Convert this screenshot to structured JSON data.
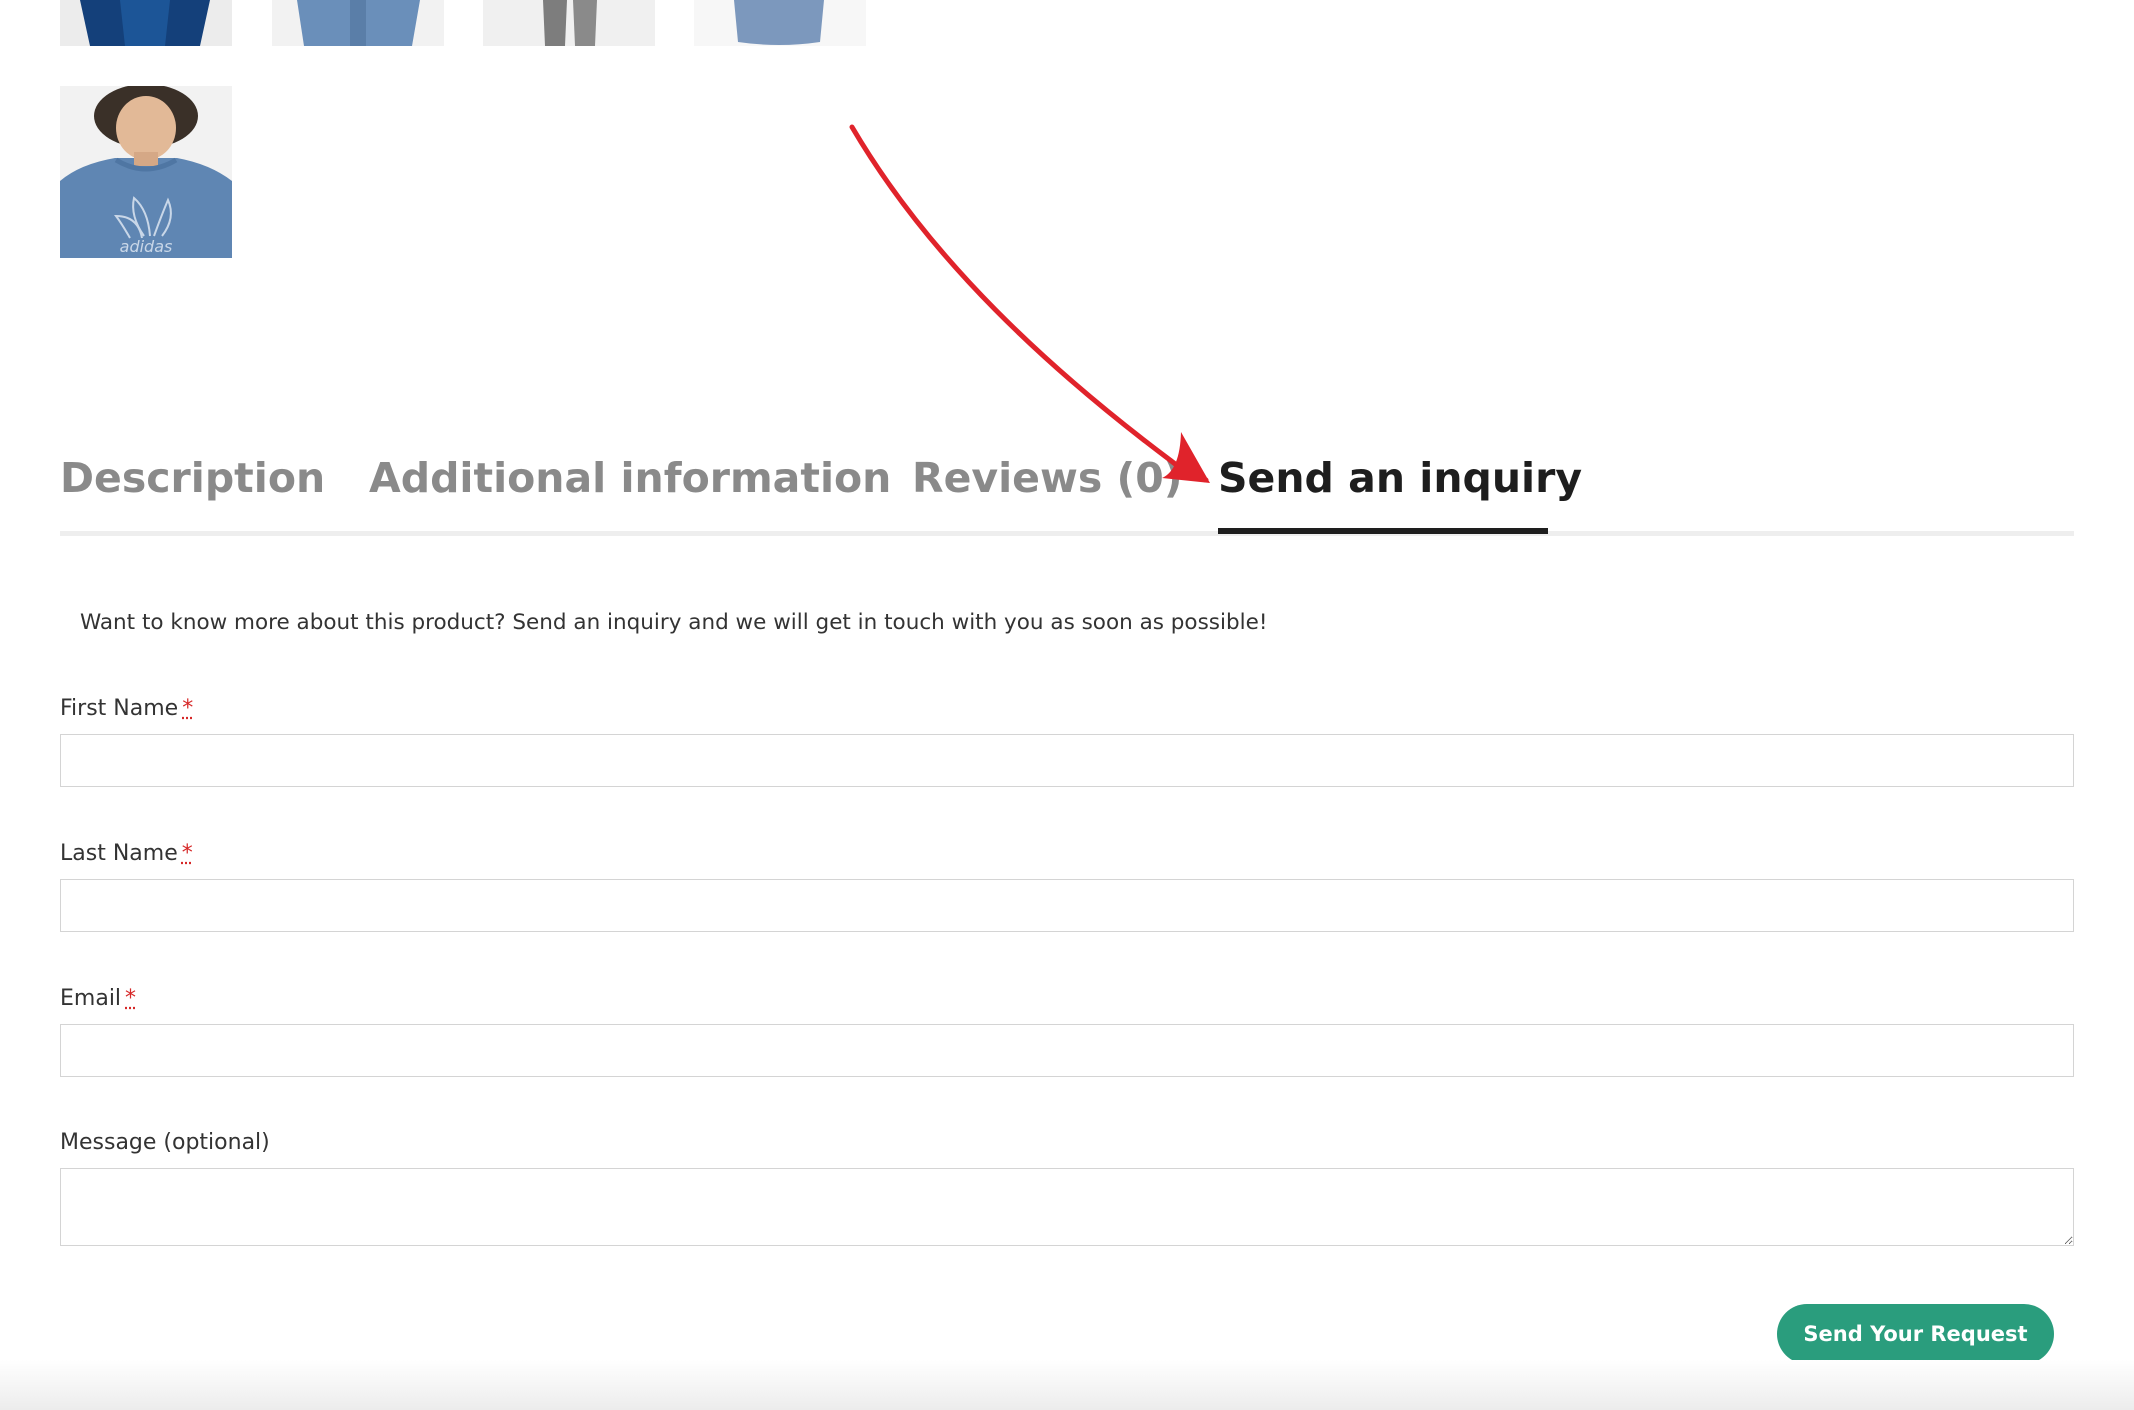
{
  "tabs": [
    {
      "label": "Description",
      "active": false
    },
    {
      "label": "Additional information",
      "active": false
    },
    {
      "label": "Reviews (0)",
      "active": false
    },
    {
      "label": "Send an inquiry",
      "active": true
    }
  ],
  "inquiry": {
    "intro": "Want to know more about this product? Send an inquiry and we will get in touch with you as soon as possible!",
    "required_marker": "*",
    "fields": {
      "first_name": {
        "label": "First Name",
        "value": ""
      },
      "last_name": {
        "label": "Last Name",
        "value": ""
      },
      "email": {
        "label": "Email",
        "value": ""
      },
      "message": {
        "label": "Message (optional)",
        "value": ""
      }
    },
    "submit_label": "Send Your Request"
  },
  "colors": {
    "accent": "#2a9d7d",
    "active_tab": "#1e1e1e",
    "inactive_tab": "#8a8a8a",
    "annotation_arrow": "#e0232b",
    "required": "#d62828"
  },
  "gallery": {
    "thumbnails": [
      "blue-shirt-model",
      "blue-shirt-back",
      "grey-pants",
      "blue-shirt-flat",
      "blue-shirt-trefoil-logo"
    ]
  }
}
